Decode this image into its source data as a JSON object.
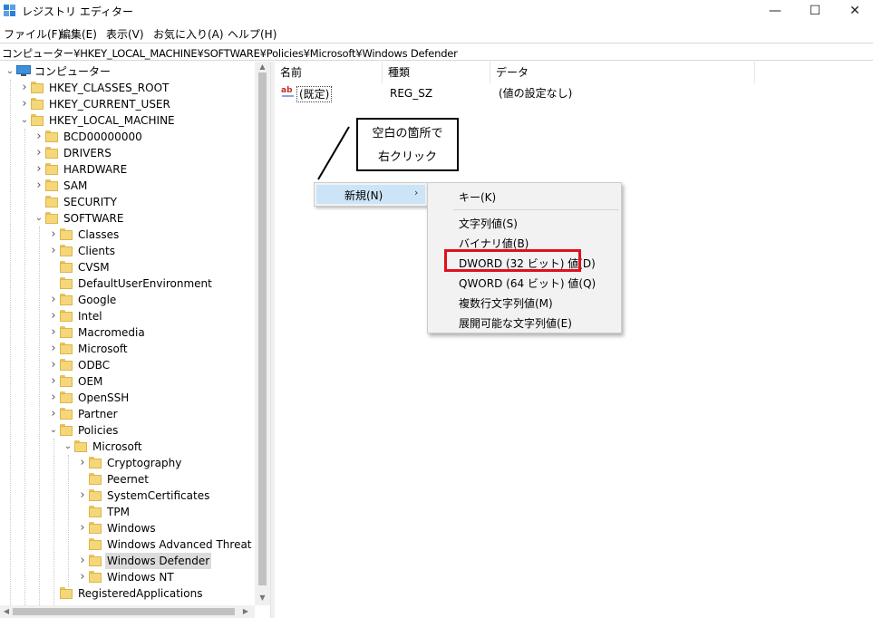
{
  "window": {
    "title": "レジストリ エディター",
    "minimize_glyph": "—",
    "maximize_glyph": "☐",
    "close_glyph": "✕",
    "icon": "registry-editor-icon"
  },
  "menu": [
    "ファイル(F)",
    "編集(E)",
    "表示(V)",
    "お気に入り(A)",
    "ヘルプ(H)"
  ],
  "address": "コンピューター¥HKEY_LOCAL_MACHINE¥SOFTWARE¥Policies¥Microsoft¥Windows Defender",
  "tree": [
    {
      "label": "コンピューター",
      "depth": 0,
      "expand": "open",
      "icon": "computer-icon"
    },
    {
      "label": "HKEY_CLASSES_ROOT",
      "depth": 1,
      "expand": "closed"
    },
    {
      "label": "HKEY_CURRENT_USER",
      "depth": 1,
      "expand": "closed"
    },
    {
      "label": "HKEY_LOCAL_MACHINE",
      "depth": 1,
      "expand": "open"
    },
    {
      "label": "BCD00000000",
      "depth": 2,
      "expand": "closed"
    },
    {
      "label": "DRIVERS",
      "depth": 2,
      "expand": "closed"
    },
    {
      "label": "HARDWARE",
      "depth": 2,
      "expand": "closed"
    },
    {
      "label": "SAM",
      "depth": 2,
      "expand": "closed"
    },
    {
      "label": "SECURITY",
      "depth": 2,
      "expand": "none"
    },
    {
      "label": "SOFTWARE",
      "depth": 2,
      "expand": "open"
    },
    {
      "label": "Classes",
      "depth": 3,
      "expand": "closed"
    },
    {
      "label": "Clients",
      "depth": 3,
      "expand": "closed"
    },
    {
      "label": "CVSM",
      "depth": 3,
      "expand": "none"
    },
    {
      "label": "DefaultUserEnvironment",
      "depth": 3,
      "expand": "none"
    },
    {
      "label": "Google",
      "depth": 3,
      "expand": "closed"
    },
    {
      "label": "Intel",
      "depth": 3,
      "expand": "closed"
    },
    {
      "label": "Macromedia",
      "depth": 3,
      "expand": "closed"
    },
    {
      "label": "Microsoft",
      "depth": 3,
      "expand": "closed"
    },
    {
      "label": "ODBC",
      "depth": 3,
      "expand": "closed"
    },
    {
      "label": "OEM",
      "depth": 3,
      "expand": "closed"
    },
    {
      "label": "OpenSSH",
      "depth": 3,
      "expand": "closed"
    },
    {
      "label": "Partner",
      "depth": 3,
      "expand": "closed"
    },
    {
      "label": "Policies",
      "depth": 3,
      "expand": "open"
    },
    {
      "label": "Microsoft",
      "depth": 4,
      "expand": "open"
    },
    {
      "label": "Cryptography",
      "depth": 5,
      "expand": "closed"
    },
    {
      "label": "Peernet",
      "depth": 5,
      "expand": "none"
    },
    {
      "label": "SystemCertificates",
      "depth": 5,
      "expand": "closed"
    },
    {
      "label": "TPM",
      "depth": 5,
      "expand": "none"
    },
    {
      "label": "Windows",
      "depth": 5,
      "expand": "closed"
    },
    {
      "label": "Windows Advanced Threat Pro",
      "depth": 5,
      "expand": "none"
    },
    {
      "label": "Windows Defender",
      "depth": 5,
      "expand": "closed",
      "selected": true
    },
    {
      "label": "Windows NT",
      "depth": 5,
      "expand": "closed"
    },
    {
      "label": "RegisteredApplications",
      "depth": 3,
      "expand": "none"
    }
  ],
  "list": {
    "columns": [
      "名前",
      "種類",
      "データ"
    ],
    "rows": [
      {
        "name": "(既定)",
        "type": "REG_SZ",
        "data": "(値の設定なし)",
        "icon": "string-value-icon"
      }
    ]
  },
  "annotation": {
    "line1": "空白の箇所で",
    "line2": "右クリック"
  },
  "context_menu": {
    "new_label": "新規(N)",
    "submenu_arrow": "›",
    "submenu": [
      "キー(K)",
      "文字列値(S)",
      "バイナリ値(B)",
      "DWORD (32 ビット) 値(D)",
      "QWORD (64 ビット) 値(Q)",
      "複数行文字列値(M)",
      "展開可能な文字列値(E)"
    ],
    "highlighted_item": "DWORD (32 ビット) 値(D)"
  },
  "colors": {
    "selection": "#cce4f7",
    "highlight": "#e0101e",
    "folder": "#f5d77a"
  }
}
